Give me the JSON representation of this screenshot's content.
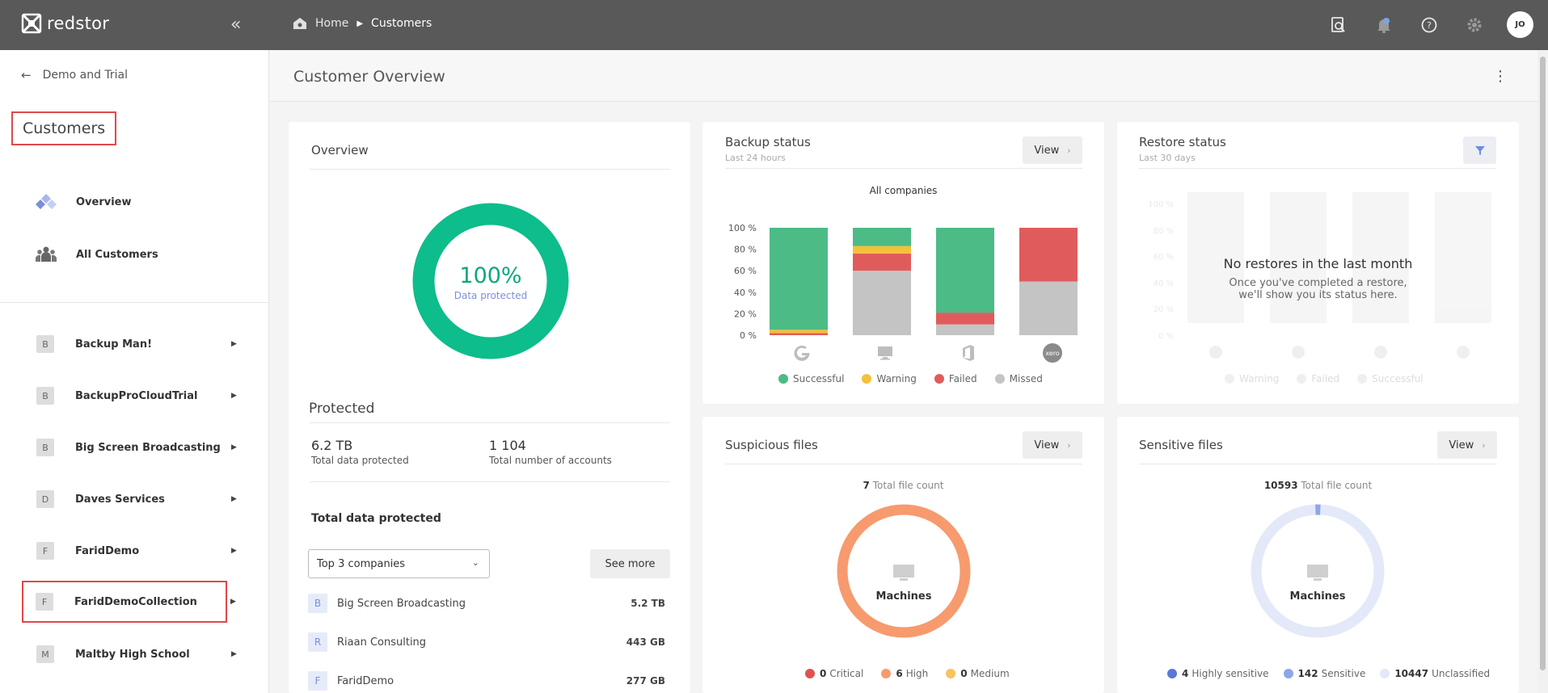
{
  "app": {
    "logo_text": "redstor",
    "user_initials": "JO"
  },
  "breadcrumb": {
    "home": "Home",
    "current": "Customers"
  },
  "sidebar": {
    "back_label": "Demo and Trial",
    "title": "Customers",
    "nav": [
      {
        "label": "Overview",
        "icon": "overview-icon"
      },
      {
        "label": "All Customers",
        "icon": "users-icon"
      }
    ],
    "customers": [
      {
        "letter": "B",
        "name": "Backup Man!"
      },
      {
        "letter": "B",
        "name": "BackupProCloudTrial"
      },
      {
        "letter": "B",
        "name": "Big Screen Broadcasting"
      },
      {
        "letter": "D",
        "name": "Daves Services"
      },
      {
        "letter": "F",
        "name": "FaridDemo"
      },
      {
        "letter": "F",
        "name": "FaridDemoCollection"
      },
      {
        "letter": "M",
        "name": "Maltby High School"
      }
    ]
  },
  "main": {
    "page_title": "Customer Overview",
    "overview": {
      "title": "Overview",
      "percent": "100%",
      "percent_label": "Data protected",
      "protected_title": "Protected",
      "total_data": "6.2 TB",
      "total_data_label": "Total data protected",
      "accounts": "1 104",
      "accounts_label": "Total number of accounts",
      "tdp_title": "Total data protected",
      "select_value": "Top 3 companies",
      "see_more": "See more",
      "top": [
        {
          "letter": "B",
          "name": "Big Screen Broadcasting",
          "size": "5.2 TB"
        },
        {
          "letter": "R",
          "name": "Riaan Consulting",
          "size": "443 GB"
        },
        {
          "letter": "F",
          "name": "FaridDemo",
          "size": "277 GB"
        }
      ]
    },
    "backup": {
      "title": "Backup status",
      "subtitle": "Last 24 hours",
      "view": "View",
      "chart_title": "All companies",
      "legend": [
        "Successful",
        "Warning",
        "Failed",
        "Missed"
      ]
    },
    "restore": {
      "title": "Restore status",
      "subtitle": "Last 30 days",
      "empty_title": "No restores in the last month",
      "empty_body1": "Once you've completed a restore,",
      "empty_body2": "we'll show you its status here.",
      "ticks": [
        "100 %",
        "80 %",
        "60 %",
        "40 %",
        "20 %",
        "0 %"
      ],
      "legend": [
        "Warning",
        "Failed",
        "Successful"
      ]
    },
    "suspicious": {
      "title": "Suspicious files",
      "view": "View",
      "count": "7",
      "count_label": "Total file count",
      "center": "Machines",
      "legend": [
        {
          "value": "0",
          "label": "Critical",
          "color": "#e05252"
        },
        {
          "value": "6",
          "label": "High",
          "color": "#f79a6e"
        },
        {
          "value": "0",
          "label": "Medium",
          "color": "#f5c55c"
        }
      ]
    },
    "sensitive": {
      "title": "Sensitive files",
      "view": "View",
      "count": "10593",
      "count_label": "Total file count",
      "center": "Machines",
      "legend": [
        {
          "value": "4",
          "label": "Highly sensitive",
          "color": "#5b78d4"
        },
        {
          "value": "142",
          "label": "Sensitive",
          "color": "#8ea6e8"
        },
        {
          "value": "10447",
          "label": "Unclassified",
          "color": "#e3e9f8"
        }
      ]
    }
  },
  "chart_data": {
    "type": "bar",
    "title": "All companies",
    "categories": [
      "Google",
      "Machines",
      "Office 365",
      "Xero"
    ],
    "ylim": [
      0,
      100
    ],
    "yticks": [
      "100 %",
      "80 %",
      "60 %",
      "40 %",
      "20 %",
      "0 %"
    ],
    "series": [
      {
        "name": "Missed",
        "color": "#c4c4c4",
        "values": [
          0,
          60,
          10,
          50
        ]
      },
      {
        "name": "Failed",
        "color": "#e05c5c",
        "values": [
          2,
          16,
          11,
          50
        ]
      },
      {
        "name": "Warning",
        "color": "#f5c03a",
        "values": [
          3,
          7,
          0,
          0
        ]
      },
      {
        "name": "Successful",
        "color": "#4cbb86",
        "values": [
          95,
          17,
          79,
          0
        ]
      }
    ],
    "legend_position": "bottom"
  }
}
